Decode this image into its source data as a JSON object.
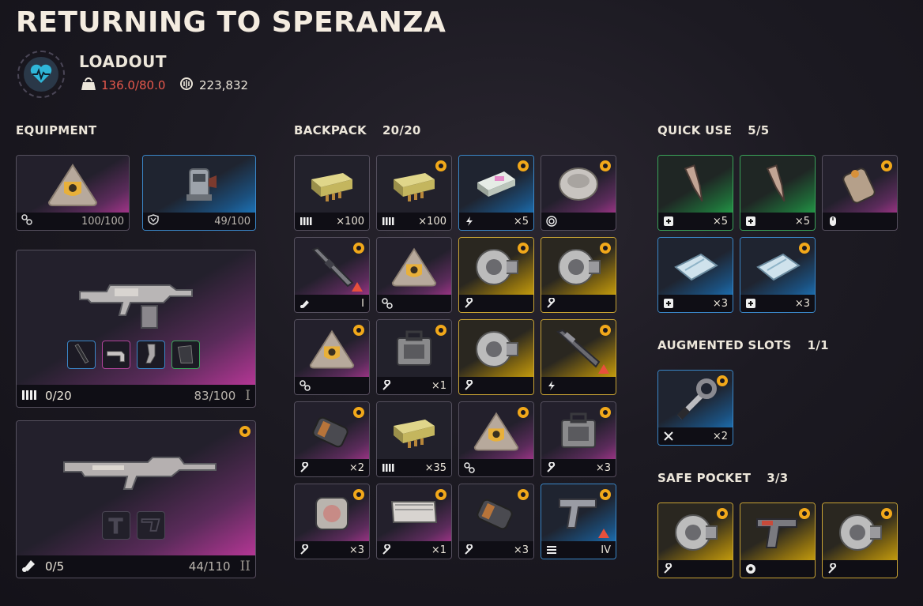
{
  "header": {
    "title": "RETURNING TO SPERANZA",
    "loadout_label": "LOADOUT",
    "weight": "136.0/80.0",
    "coins": "223,832"
  },
  "equipment": {
    "label": "EQUIPMENT",
    "augment": {
      "stat": "100/100",
      "icon": "augment-icon",
      "item": "augment-chip"
    },
    "shield": {
      "stat": "49/100",
      "icon": "shield-icon",
      "item": "shield-device"
    },
    "weapon1": {
      "ammo": "0/20",
      "durability": "83/100",
      "tier": "I",
      "ammo_icon": "light-ammo-icon",
      "mods": [
        "barrel-mod",
        "grip-mod",
        "underbarrel-mod",
        "magazine-mod"
      ]
    },
    "weapon2": {
      "ammo": "0/5",
      "durability": "44/110",
      "tier": "II",
      "ammo_icon": "heavy-ammo-icon",
      "mods": [
        "empty-mod-slot-t",
        "empty-mod-slot-stock"
      ]
    }
  },
  "backpack": {
    "label": "BACKPACK",
    "count": "20/20",
    "slots": [
      {
        "rarity": "gray",
        "icon": "light-ammo-icon",
        "qty": "×100",
        "item": "ammo-box",
        "badge": false
      },
      {
        "rarity": "gray",
        "icon": "light-ammo-icon",
        "qty": "×100",
        "item": "ammo-box",
        "badge": true
      },
      {
        "rarity": "blue",
        "icon": "energy-icon",
        "qty": "×5",
        "item": "battery-pack",
        "badge": true
      },
      {
        "rarity": "pink",
        "icon": "target-icon",
        "qty": "",
        "item": "trap-disc",
        "badge": true
      },
      {
        "rarity": "pink",
        "icon": "grenade-icon",
        "qty": "I",
        "item": "rifle-barrel",
        "badge": true,
        "warn": true
      },
      {
        "rarity": "pink",
        "icon": "augment-icon",
        "qty": "",
        "item": "augment-chip",
        "badge": false
      },
      {
        "rarity": "yellow",
        "icon": "wrench-icon",
        "qty": "",
        "item": "engine-part",
        "badge": true
      },
      {
        "rarity": "yellow",
        "icon": "wrench-icon",
        "qty": "",
        "item": "engine-part",
        "badge": true
      },
      {
        "rarity": "pink",
        "icon": "augment-icon",
        "qty": "",
        "item": "augment-chip",
        "badge": true
      },
      {
        "rarity": "gray",
        "icon": "wrench-icon",
        "qty": "×1",
        "item": "toolbox",
        "badge": true
      },
      {
        "rarity": "yellow",
        "icon": "wrench-icon",
        "qty": "",
        "item": "engine-part",
        "badge": false
      },
      {
        "rarity": "yellow",
        "icon": "energy-icon",
        "qty": "",
        "item": "rifle-part",
        "badge": true,
        "warn": true
      },
      {
        "rarity": "pink",
        "icon": "wrench-icon",
        "qty": "×2",
        "item": "canister",
        "badge": true
      },
      {
        "rarity": "gray",
        "icon": "light-ammo-icon",
        "qty": "×35",
        "item": "ammo-box",
        "badge": false
      },
      {
        "rarity": "pink",
        "icon": "augment-icon",
        "qty": "",
        "item": "augment-chip",
        "badge": true
      },
      {
        "rarity": "pink",
        "icon": "wrench-icon",
        "qty": "×3",
        "item": "toolbox",
        "badge": true
      },
      {
        "rarity": "pink",
        "icon": "wrench-icon",
        "qty": "×3",
        "item": "fuse-part",
        "badge": true
      },
      {
        "rarity": "pink",
        "icon": "wrench-icon",
        "qty": "×1",
        "item": "metal-plate",
        "badge": true
      },
      {
        "rarity": "gray",
        "icon": "wrench-icon",
        "qty": "×3",
        "item": "canister",
        "badge": true
      },
      {
        "rarity": "blue",
        "icon": "mag-icon",
        "qty": "IV",
        "item": "pistol",
        "badge": true,
        "warn": true
      }
    ]
  },
  "quick_use": {
    "label": "QUICK USE",
    "count": "5/5",
    "slots": [
      {
        "rarity": "green",
        "icon": "heal-icon",
        "qty": "×5",
        "item": "injector"
      },
      {
        "rarity": "green",
        "icon": "heal-icon",
        "qty": "×5",
        "item": "injector"
      },
      {
        "rarity": "pink",
        "icon": "mouse-icon",
        "qty": "",
        "item": "grenade-canister",
        "badge": true
      },
      {
        "rarity": "blue",
        "icon": "heal-icon",
        "qty": "×3",
        "item": "bandage"
      },
      {
        "rarity": "blue",
        "icon": "heal-icon",
        "qty": "×3",
        "item": "bandage",
        "badge": true
      }
    ]
  },
  "augmented": {
    "label": "AUGMENTED SLOTS",
    "count": "1/1",
    "slot": {
      "rarity": "blue",
      "icon": "tools-icon",
      "qty": "×2",
      "item": "wrench-tool",
      "badge": true
    }
  },
  "safe_pocket": {
    "label": "SAFE POCKET",
    "count": "3/3",
    "slots": [
      {
        "rarity": "yellow",
        "icon": "wrench-icon",
        "qty": "",
        "item": "engine-part",
        "badge": true
      },
      {
        "rarity": "yellow",
        "icon": "aperture-icon",
        "qty": "",
        "item": "drill-gun",
        "badge": true
      },
      {
        "rarity": "yellow",
        "icon": "wrench-icon",
        "qty": "",
        "item": "engine-part",
        "badge": true
      }
    ]
  }
}
